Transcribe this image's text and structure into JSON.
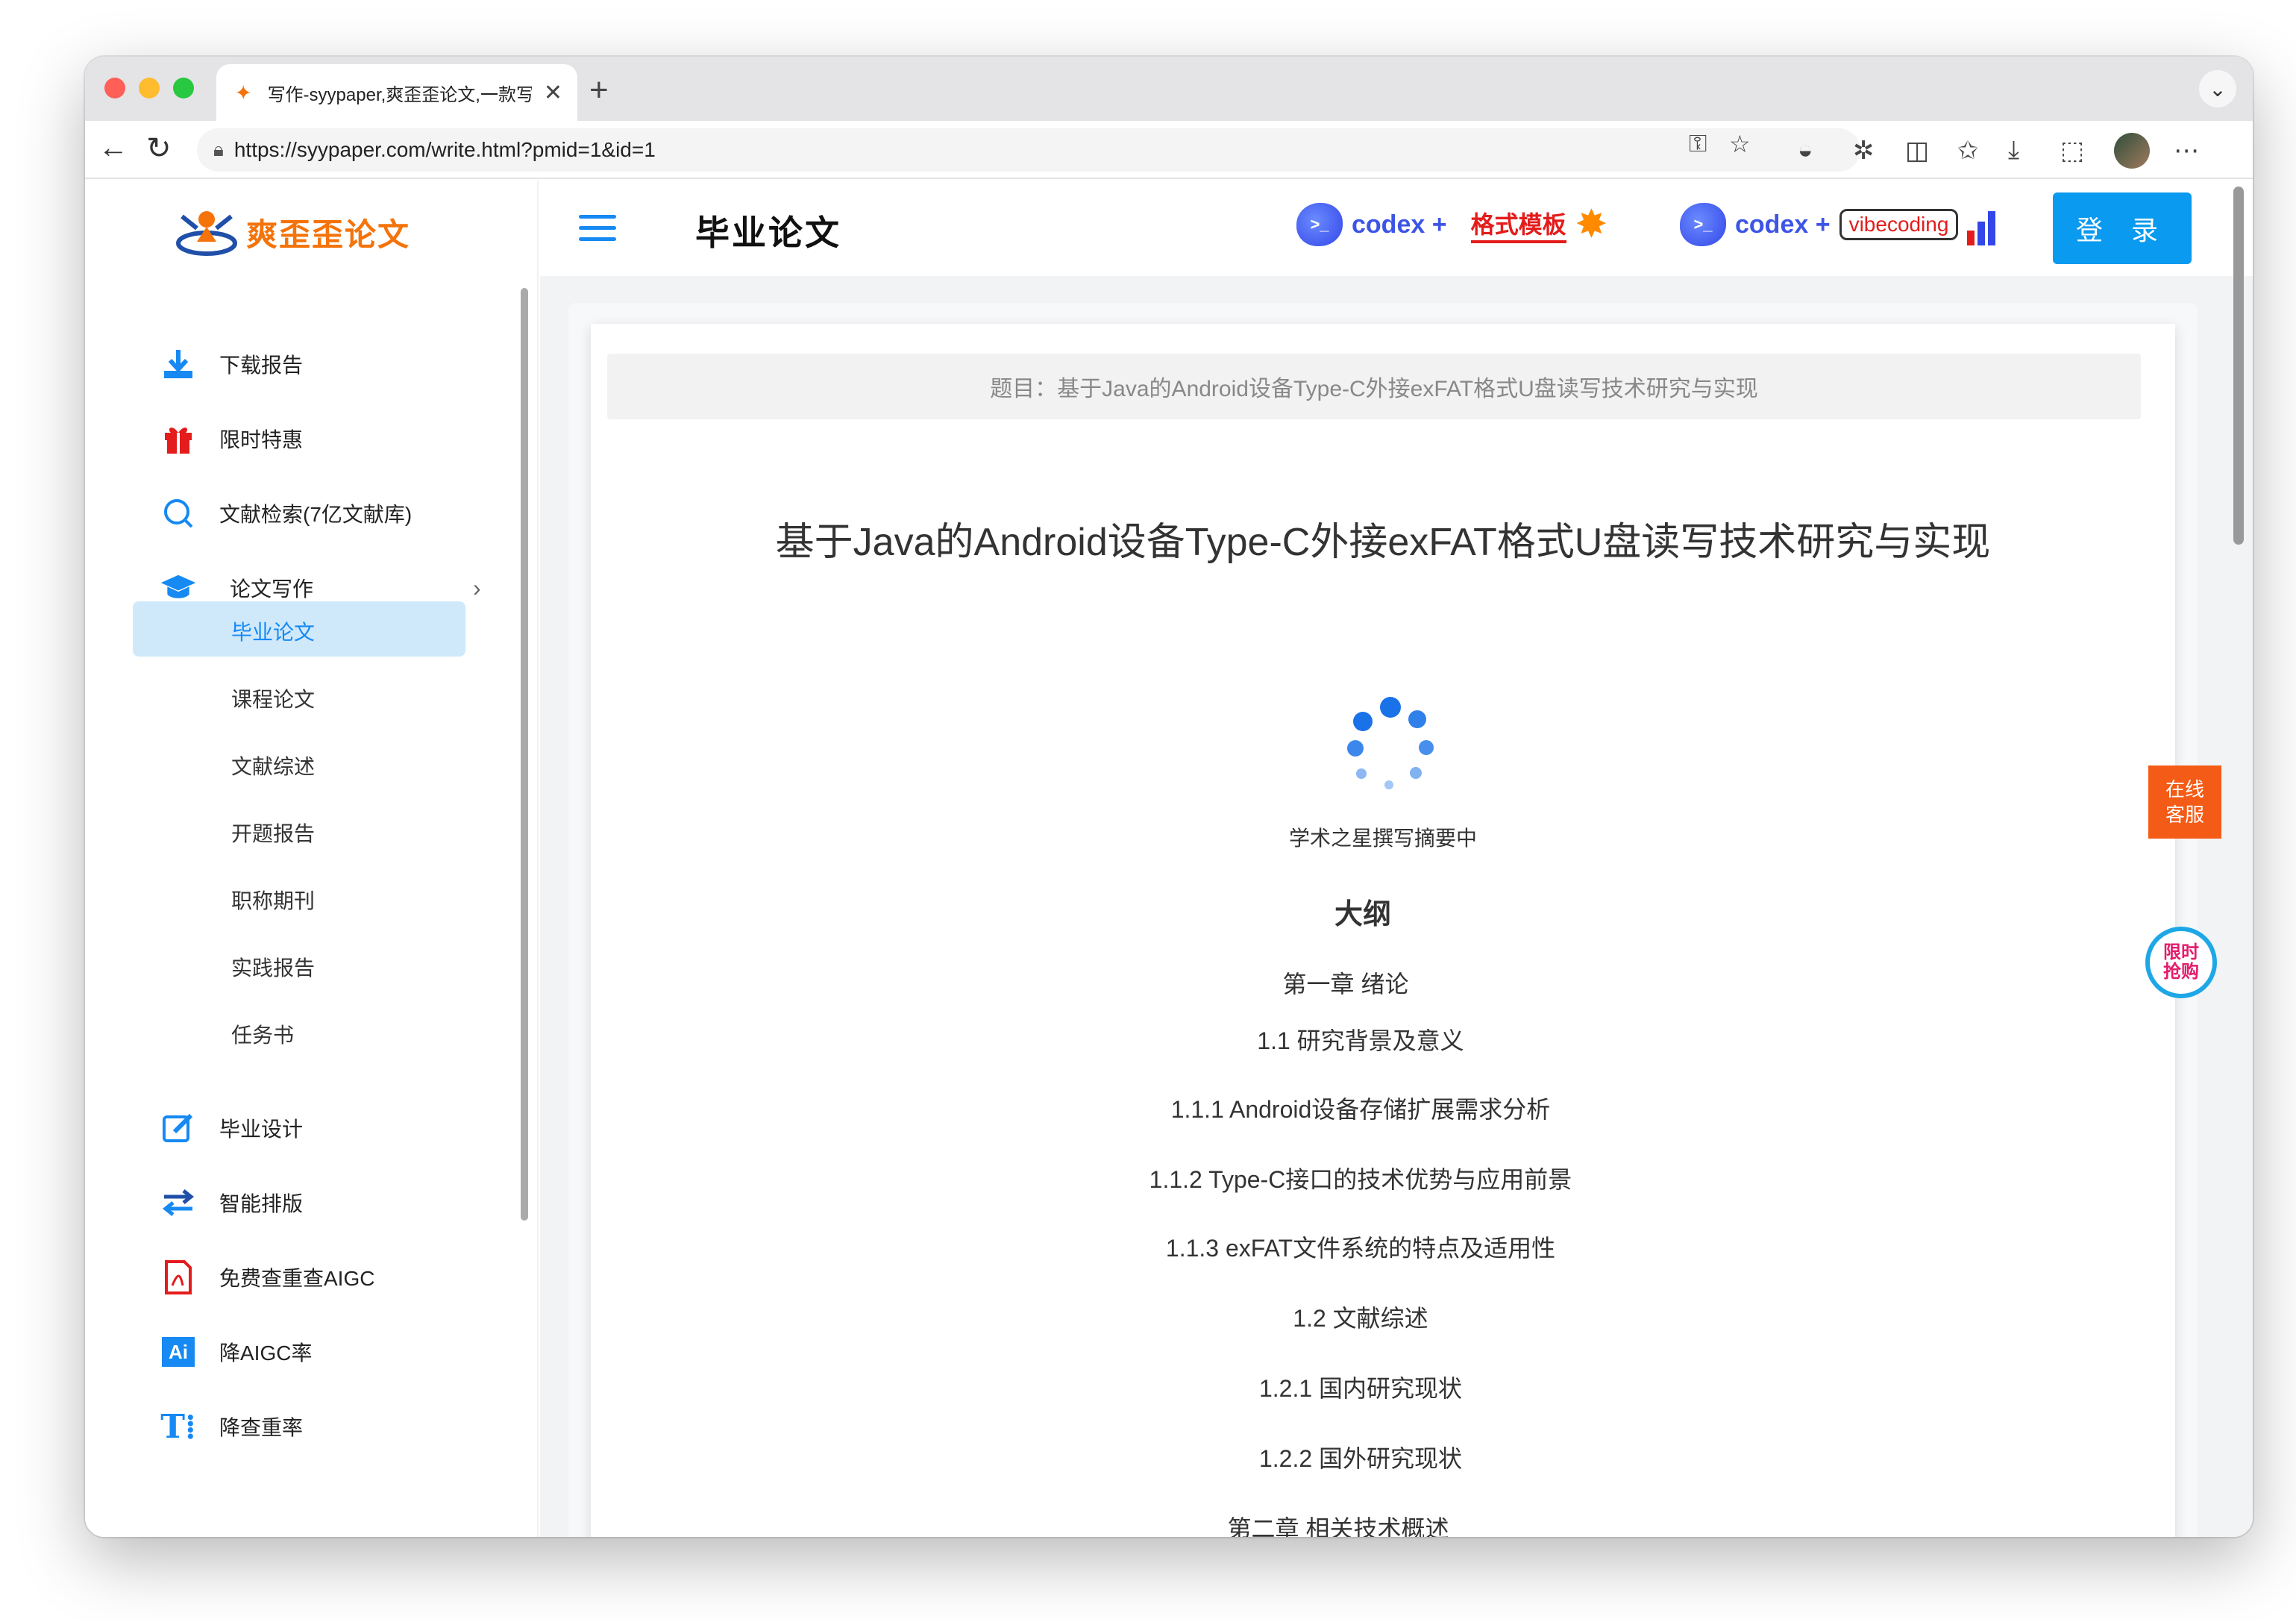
{
  "browser": {
    "tab_title": "写作-syypaper,爽歪歪论文,一款写",
    "url": "https://syypaper.com/write.html?pmid=1&id=1"
  },
  "site": {
    "logo_text": "爽歪歪论文",
    "page_title": "毕业论文",
    "login_label": "登 录",
    "ads": {
      "codex1": "codex +",
      "template": "格式模板",
      "codex2": "codex +",
      "vibecoding": "vibecoding"
    }
  },
  "sidebar": {
    "items": [
      {
        "label": "下载报告",
        "icon": "download-icon"
      },
      {
        "label": "限时特惠",
        "icon": "gift-icon"
      },
      {
        "label": "文献检索(7亿文献库)",
        "icon": "search-icon"
      },
      {
        "label": "论文写作",
        "icon": "graduation-cap-icon"
      }
    ],
    "sub_items": [
      "毕业论文",
      "课程论文",
      "文献综述",
      "开题报告",
      "职称期刊",
      "实践报告",
      "任务书"
    ],
    "bottom_items": [
      {
        "label": "毕业设计",
        "icon": "edit-icon"
      },
      {
        "label": "智能排版",
        "icon": "swap-icon"
      },
      {
        "label": "免费查重查AIGC",
        "icon": "pdf-icon"
      },
      {
        "label": "降AIGC率",
        "icon": "ai-icon"
      },
      {
        "label": "降查重率",
        "icon": "text-icon"
      }
    ]
  },
  "document": {
    "topic_label": "题目：基于Java的Android设备Type-C外接exFAT格式U盘读写技术研究与实现",
    "title": "基于Java的Android设备Type-C外接exFAT格式U盘读写技术研究与实现",
    "loading_text": "学术之星撰写摘要中",
    "outline_title": "大纲",
    "outline": [
      "第一章 绪论",
      "1.1 研究背景及意义",
      "1.1.1 Android设备存储扩展需求分析",
      "1.1.2 Type-C接口的技术优势与应用前景",
      "1.1.3 exFAT文件系统的特点及适用性",
      "1.2 文献综述",
      "1.2.1 国内研究现状",
      "1.2.2 国外研究现状",
      "第二章 相关技术概述"
    ]
  },
  "floats": {
    "service_line1": "在线",
    "service_line2": "客服",
    "promo_line1": "限时",
    "promo_line2": "抢购"
  }
}
